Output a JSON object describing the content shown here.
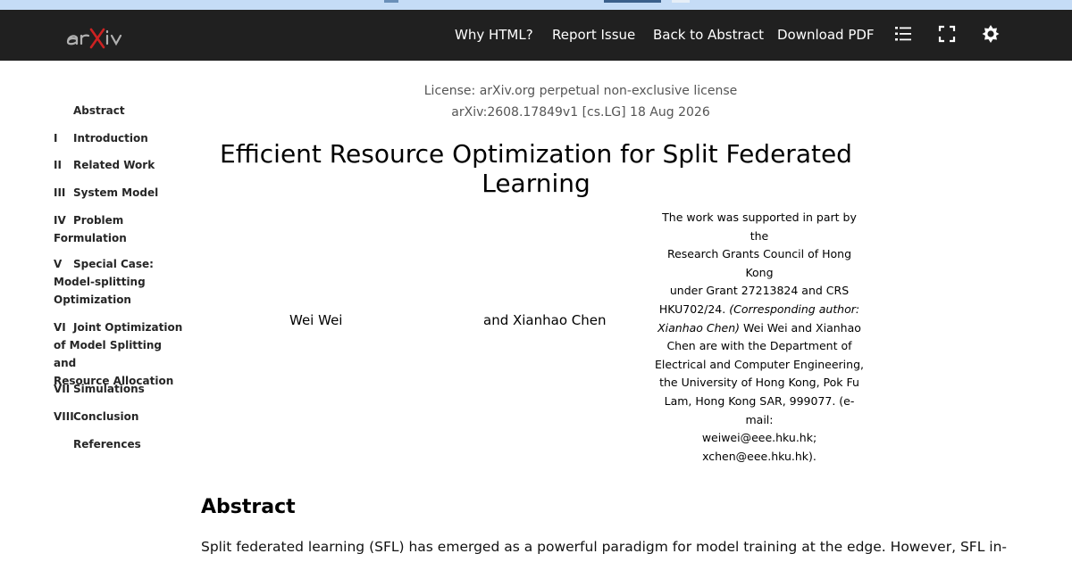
{
  "navbar": {
    "logo_text": "arXiv",
    "links": {
      "why_html": "Why HTML?",
      "report_issue": "Report Issue",
      "back_to_abstract": "Back to Abstract",
      "download_pdf": "Download PDF"
    },
    "icons": [
      "toc-list-icon",
      "fullscreen-icon",
      "theme-toggle-icon"
    ]
  },
  "toc": {
    "items": [
      {
        "num": "",
        "label": "Abstract"
      },
      {
        "num": "I",
        "label": "Introduction"
      },
      {
        "num": "II",
        "label": "Related Work"
      },
      {
        "num": "III",
        "label": "System Model"
      },
      {
        "num": "IV",
        "label": "Problem",
        "label2": "Formulation"
      },
      {
        "num": "V",
        "label": "Special Case:",
        "label2": "Model-splitting",
        "label3": "Optimization"
      },
      {
        "num": "VI",
        "label": "Joint Optimization",
        "label2": "of Model Splitting and",
        "label3": "Resource Allocation"
      },
      {
        "num": "VII",
        "label": "Simulations"
      },
      {
        "num": "VIII",
        "label": "Conclusion"
      },
      {
        "num": "",
        "label": "References"
      }
    ]
  },
  "paper": {
    "license": "License: arXiv.org perpetual non-exclusive license",
    "arxiv_id": "arXiv:2608.17849v1 [cs.LG] 18 Aug 2026",
    "title": "Efficient Resource Optimization for Split Federated Learning",
    "authors": [
      "Wei Wei",
      "and Xianhao Chen"
    ],
    "footnote_lines": [
      "The work was supported in part by the",
      "Research Grants Council of Hong Kong",
      "under Grant 27213824 and CRS",
      "HKU702/24.",
      "(Corresponding author:",
      "Xianhao Chen)",
      "Wei Wei and Xianhao",
      "Chen are with the Department of",
      "Electrical and Computer Engineering,",
      "the University of Hong Kong, Pok Fu",
      "Lam, Hong Kong SAR, 999077. (e-mail:",
      "weiwei@eee.hku.hk;",
      "xchen@eee.hku.hk)."
    ],
    "abstract_heading": "Abstract",
    "abstract_first_line": "Split federated learning (SFL) has emerged as a powerful paradigm for model training at the edge. However, SFL in-"
  }
}
